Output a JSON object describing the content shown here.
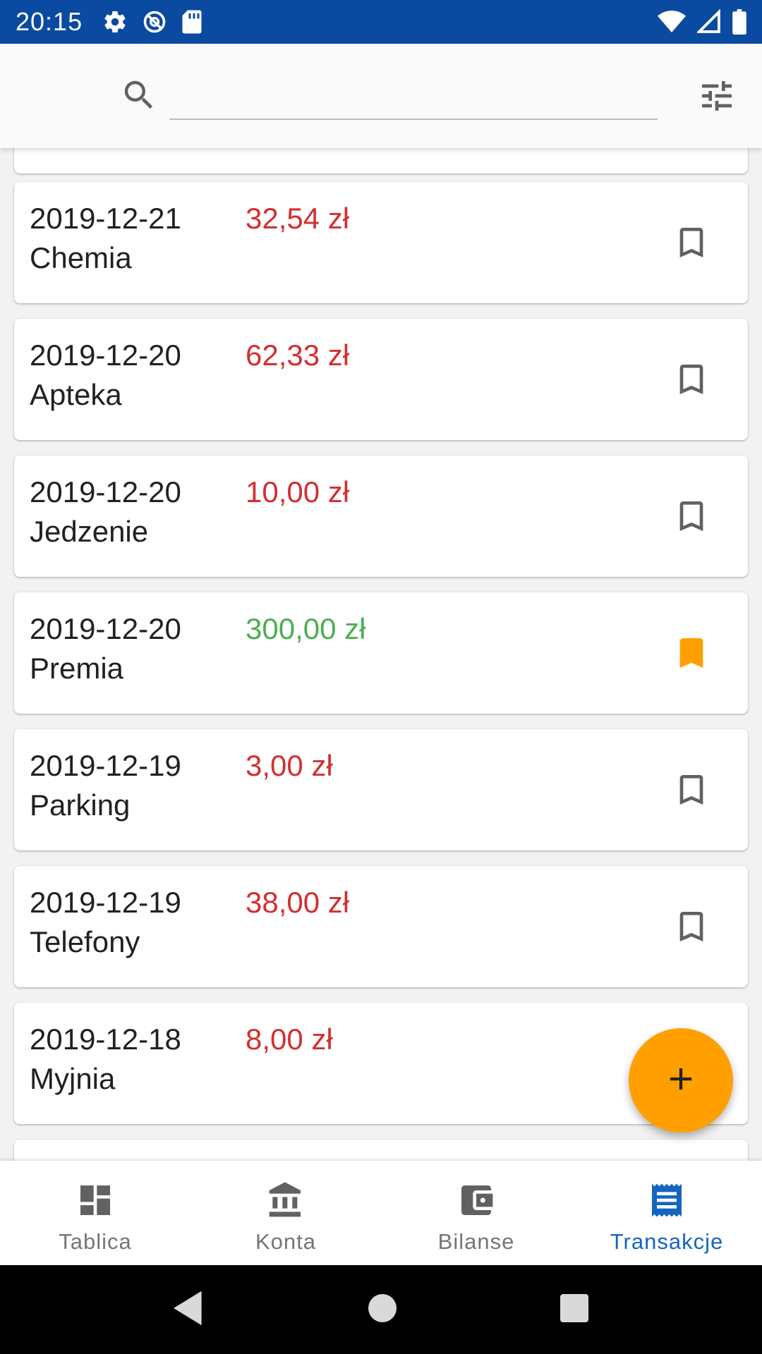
{
  "status_bar": {
    "time": "20:15"
  },
  "search": {
    "value": "",
    "placeholder": ""
  },
  "transactions": [
    {
      "date": "2019-12-21",
      "category": "Chemia",
      "amount": "32,54 zł",
      "type": "expense",
      "bookmarked": false
    },
    {
      "date": "2019-12-20",
      "category": "Apteka",
      "amount": "62,33 zł",
      "type": "expense",
      "bookmarked": false
    },
    {
      "date": "2019-12-20",
      "category": "Jedzenie",
      "amount": "10,00 zł",
      "type": "expense",
      "bookmarked": false
    },
    {
      "date": "2019-12-20",
      "category": "Premia",
      "amount": "300,00 zł",
      "type": "income",
      "bookmarked": true
    },
    {
      "date": "2019-12-19",
      "category": "Parking",
      "amount": "3,00 zł",
      "type": "expense",
      "bookmarked": false
    },
    {
      "date": "2019-12-19",
      "category": "Telefony",
      "amount": "38,00 zł",
      "type": "expense",
      "bookmarked": false
    },
    {
      "date": "2019-12-18",
      "category": "Myjnia",
      "amount": "8,00 zł",
      "type": "expense",
      "bookmarked": false
    }
  ],
  "bottom_nav": {
    "items": [
      {
        "label": "Tablica",
        "icon": "dashboard-icon",
        "active": false
      },
      {
        "label": "Konta",
        "icon": "bank-icon",
        "active": false
      },
      {
        "label": "Bilanse",
        "icon": "wallet-icon",
        "active": false
      },
      {
        "label": "Transakcje",
        "icon": "receipt-icon",
        "active": true
      }
    ]
  },
  "colors": {
    "status_bar": "#0a4aa0",
    "expense": "#d32f2f",
    "income": "#4caf50",
    "bookmark_active": "#ffa000",
    "bookmark_inactive": "#616161",
    "fab": "#ffa000",
    "nav_active": "#1565c0",
    "nav_inactive": "#757575"
  }
}
